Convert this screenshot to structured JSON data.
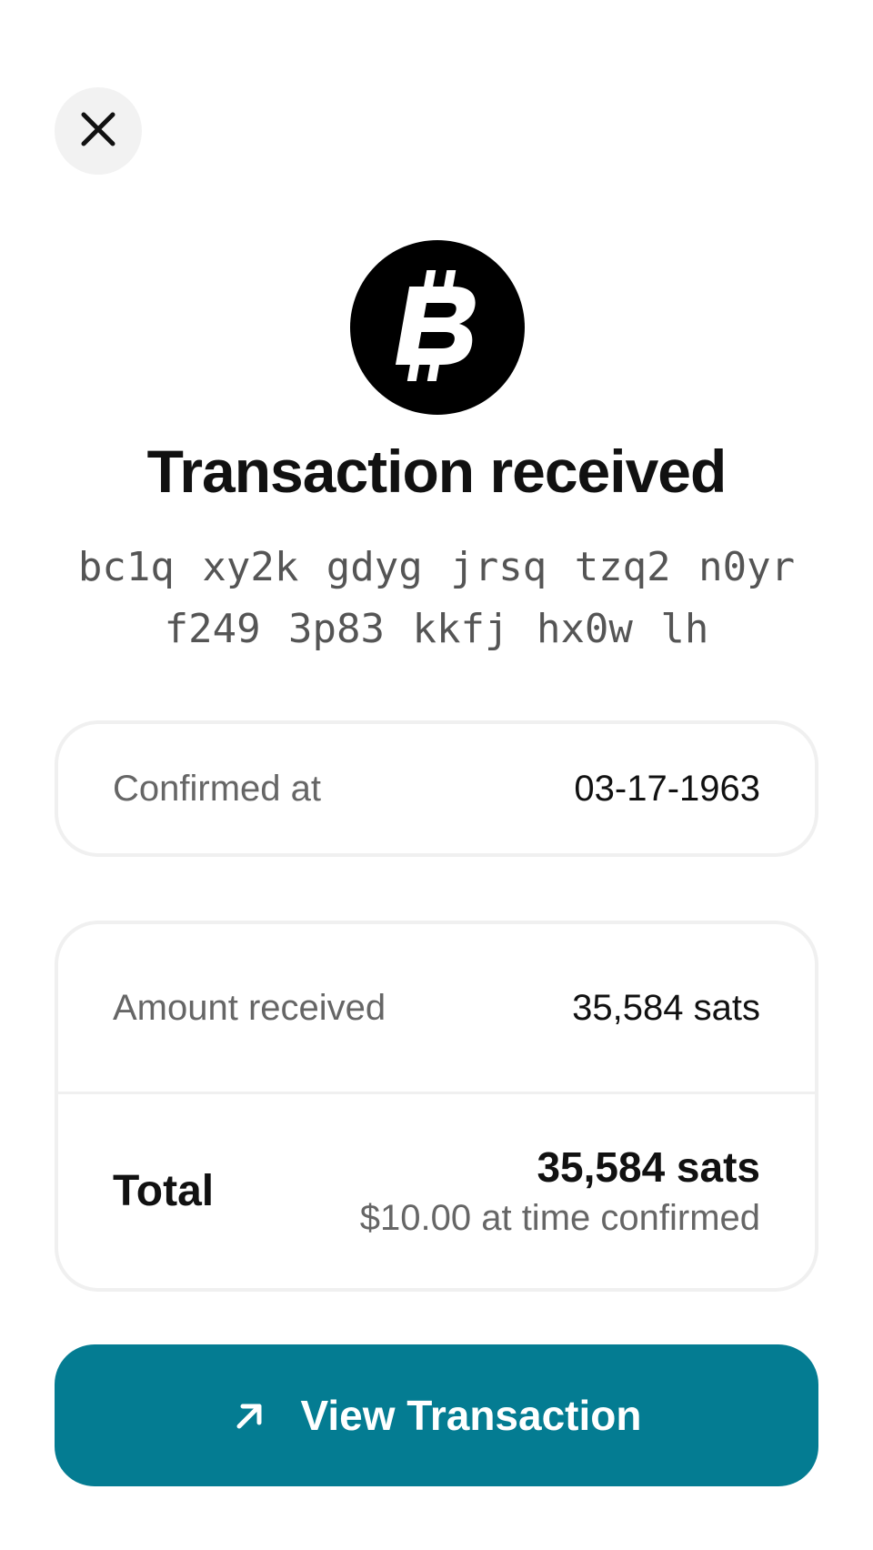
{
  "close_button": {
    "icon": "close-icon"
  },
  "logo": {
    "icon": "bitcoin-icon",
    "color": "#000000"
  },
  "title": "Transaction received",
  "address": {
    "line1": "bc1q xy2k gdyg jrsq tzq2 n0yr",
    "line2": "f249 3p83 kkfj hx0w lh"
  },
  "confirmed": {
    "label": "Confirmed at",
    "value": "03-17-1963"
  },
  "amount": {
    "label": "Amount received",
    "value": "35,584 sats"
  },
  "total": {
    "label": "Total",
    "sats": "35,584 sats",
    "fiat": "$10.00 at time confirmed"
  },
  "action": {
    "label": "View Transaction",
    "icon": "arrow-up-right-icon",
    "color": "#047c92"
  }
}
